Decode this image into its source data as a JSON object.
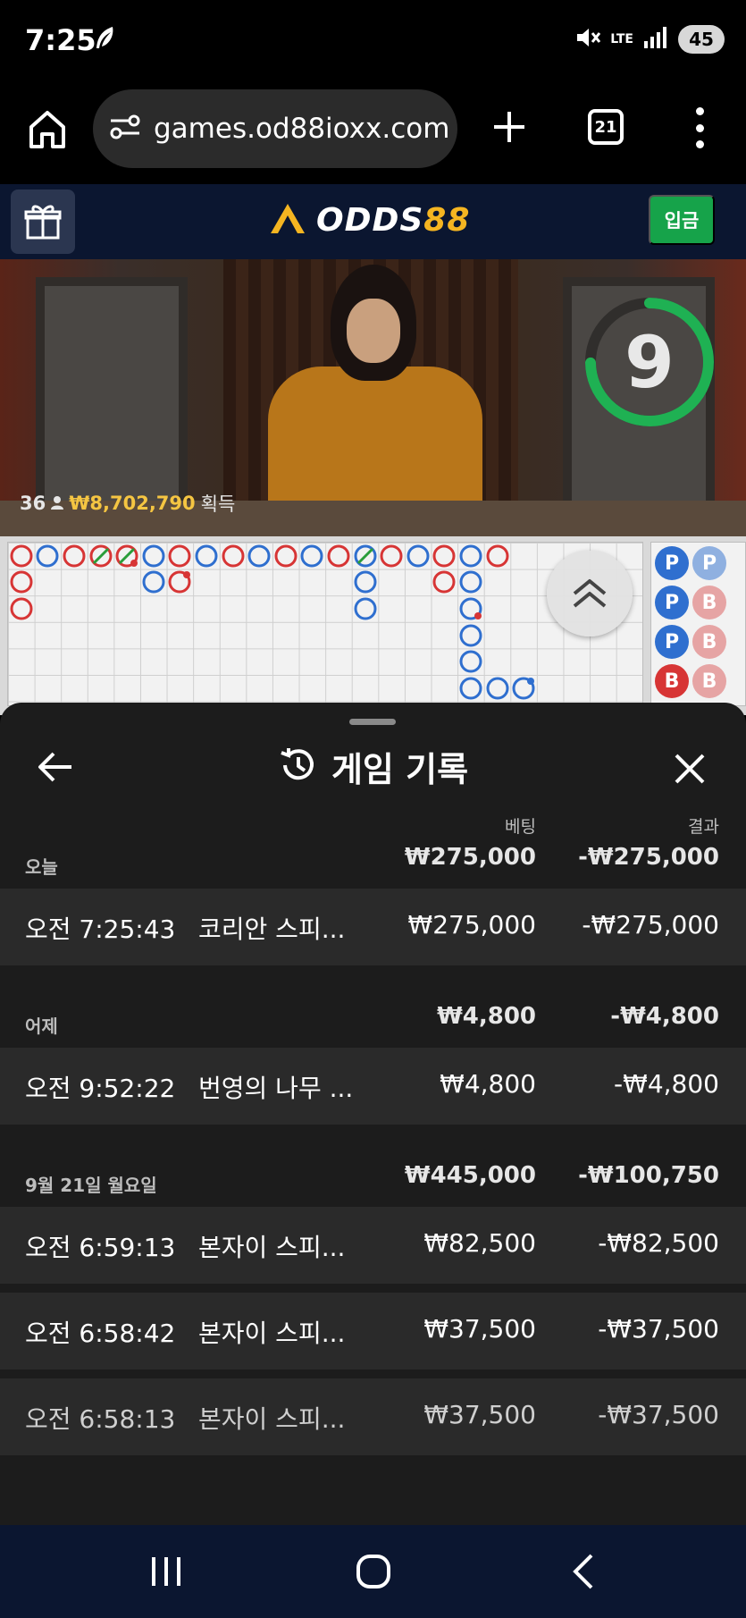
{
  "status": {
    "time": "7:25",
    "network": "LTE",
    "battery": "45"
  },
  "browser": {
    "url": "games.od88ioxx.com",
    "tab_count": "21"
  },
  "site": {
    "logo_main": "ODDS",
    "logo_num": "88",
    "deposit_label": "입금"
  },
  "video": {
    "countdown": "9",
    "player_count": "36",
    "winnings": "₩8,702,790",
    "winnings_suffix": "획득"
  },
  "roadmap": {
    "bead_labels": [
      "P",
      "P",
      "P",
      "B",
      "P",
      "B",
      "B",
      "B"
    ]
  },
  "sheet": {
    "title": "게임 기록",
    "col_bet": "베팅",
    "col_result": "결과",
    "groups": [
      {
        "title": "오늘",
        "bet": "₩275,000",
        "result": "-₩275,000",
        "rows": [
          {
            "time": "오전 7:25:43",
            "game": "코리안 스피...",
            "bet": "₩275,000",
            "result": "-₩275,000"
          }
        ]
      },
      {
        "title": "어제",
        "bet": "₩4,800",
        "result": "-₩4,800",
        "rows": [
          {
            "time": "오전 9:52:22",
            "game": "번영의 나무 ...",
            "bet": "₩4,800",
            "result": "-₩4,800"
          }
        ]
      },
      {
        "title": "9월 21일 월요일",
        "bet": "₩445,000",
        "result": "-₩100,750",
        "rows": [
          {
            "time": "오전 6:59:13",
            "game": "본자이 스피...",
            "bet": "₩82,500",
            "result": "-₩82,500"
          },
          {
            "time": "오전 6:58:42",
            "game": "본자이 스피...",
            "bet": "₩37,500",
            "result": "-₩37,500"
          },
          {
            "time": "오전 6:58:13",
            "game": "본자이 스피...",
            "bet": "₩37,500",
            "result": "-₩37,500"
          }
        ]
      }
    ]
  },
  "colors": {
    "header_bg": "#0b1630",
    "deposit_green": "#16a34a",
    "logo_gold": "#f5b521",
    "banker_red": "#d73535",
    "player_blue": "#2f6fcf",
    "sheet_bg": "#1c1c1c"
  }
}
